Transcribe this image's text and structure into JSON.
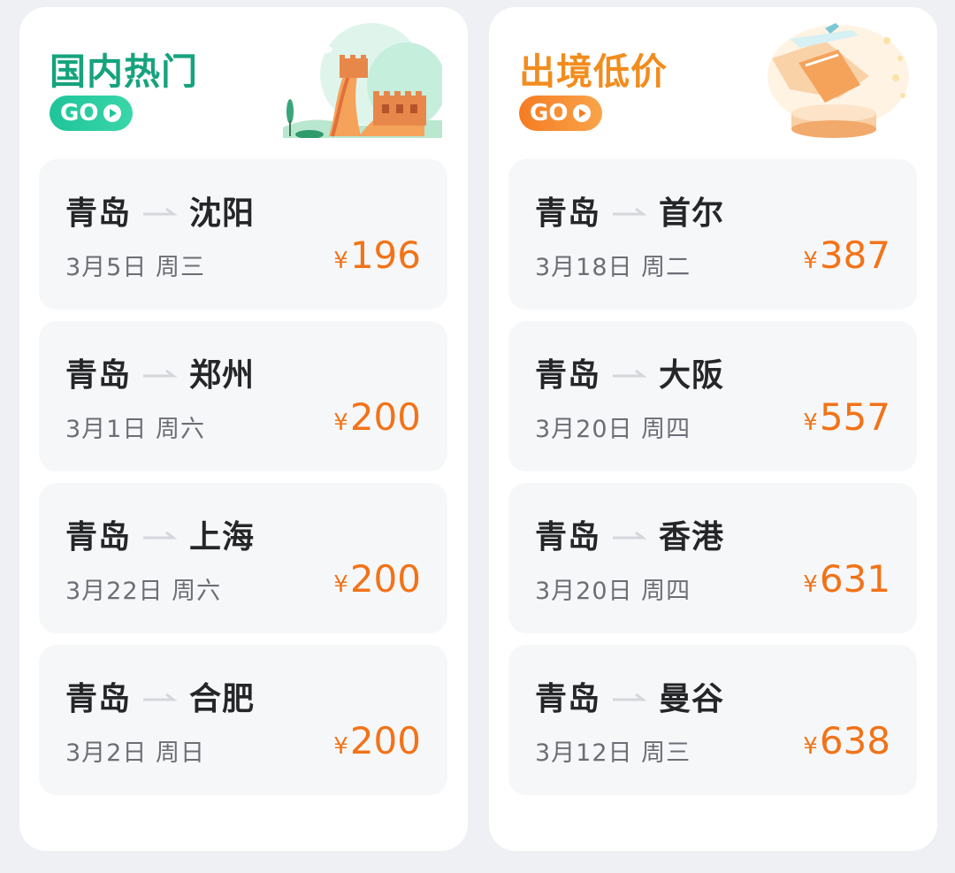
{
  "panels": [
    {
      "title": "国内热门",
      "go_label": "GO",
      "routes": [
        {
          "from": "青岛",
          "to": "沈阳",
          "date": "3月5日 周三",
          "currency": "¥",
          "price": "196"
        },
        {
          "from": "青岛",
          "to": "郑州",
          "date": "3月1日 周六",
          "currency": "¥",
          "price": "200"
        },
        {
          "from": "青岛",
          "to": "上海",
          "date": "3月22日 周六",
          "currency": "¥",
          "price": "200"
        },
        {
          "from": "青岛",
          "to": "合肥",
          "date": "3月2日 周日",
          "currency": "¥",
          "price": "200"
        }
      ]
    },
    {
      "title": "出境低价",
      "go_label": "GO",
      "routes": [
        {
          "from": "青岛",
          "to": "首尔",
          "date": "3月18日 周二",
          "currency": "¥",
          "price": "387"
        },
        {
          "from": "青岛",
          "to": "大阪",
          "date": "3月20日 周四",
          "currency": "¥",
          "price": "557"
        },
        {
          "from": "青岛",
          "to": "香港",
          "date": "3月20日 周四",
          "currency": "¥",
          "price": "631"
        },
        {
          "from": "青岛",
          "to": "曼谷",
          "date": "3月12日 周三",
          "currency": "¥",
          "price": "638"
        }
      ]
    }
  ],
  "icons": {
    "left_illustration": "great-wall-illustration",
    "right_illustration": "airplane-illustration",
    "route_arrow": "arrow-right-icon",
    "go_arrow": "play-triangle-icon"
  },
  "colors": {
    "domestic_accent": "#16a37d",
    "international_accent": "#f28c1d",
    "price": "#f27318"
  }
}
